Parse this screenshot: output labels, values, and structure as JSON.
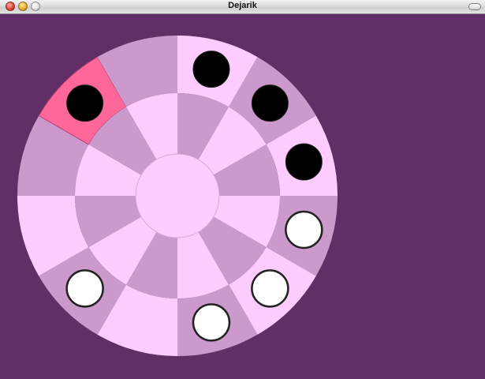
{
  "window": {
    "title": "Dejarik"
  },
  "colors": {
    "background": "#612f66",
    "light_cell": "#ffccff",
    "dark_cell": "#cc99cc",
    "selected_cell": "#ff6699",
    "black_piece": "#000000",
    "white_piece": "#ffffff"
  },
  "board": {
    "center": "center-circle",
    "inner_ring_cells": 12,
    "outer_ring_cells": 12,
    "selected": {
      "ring": "outer",
      "index": 10
    },
    "pieces": [
      {
        "player": "black",
        "ring": "outer",
        "index": 0
      },
      {
        "player": "black",
        "ring": "outer",
        "index": 1
      },
      {
        "player": "black",
        "ring": "outer",
        "index": 2
      },
      {
        "player": "black",
        "ring": "outer",
        "index": 10
      },
      {
        "player": "white",
        "ring": "outer",
        "index": 3
      },
      {
        "player": "white",
        "ring": "outer",
        "index": 4
      },
      {
        "player": "white",
        "ring": "outer",
        "index": 5
      },
      {
        "player": "white",
        "ring": "outer",
        "index": 7
      }
    ]
  }
}
